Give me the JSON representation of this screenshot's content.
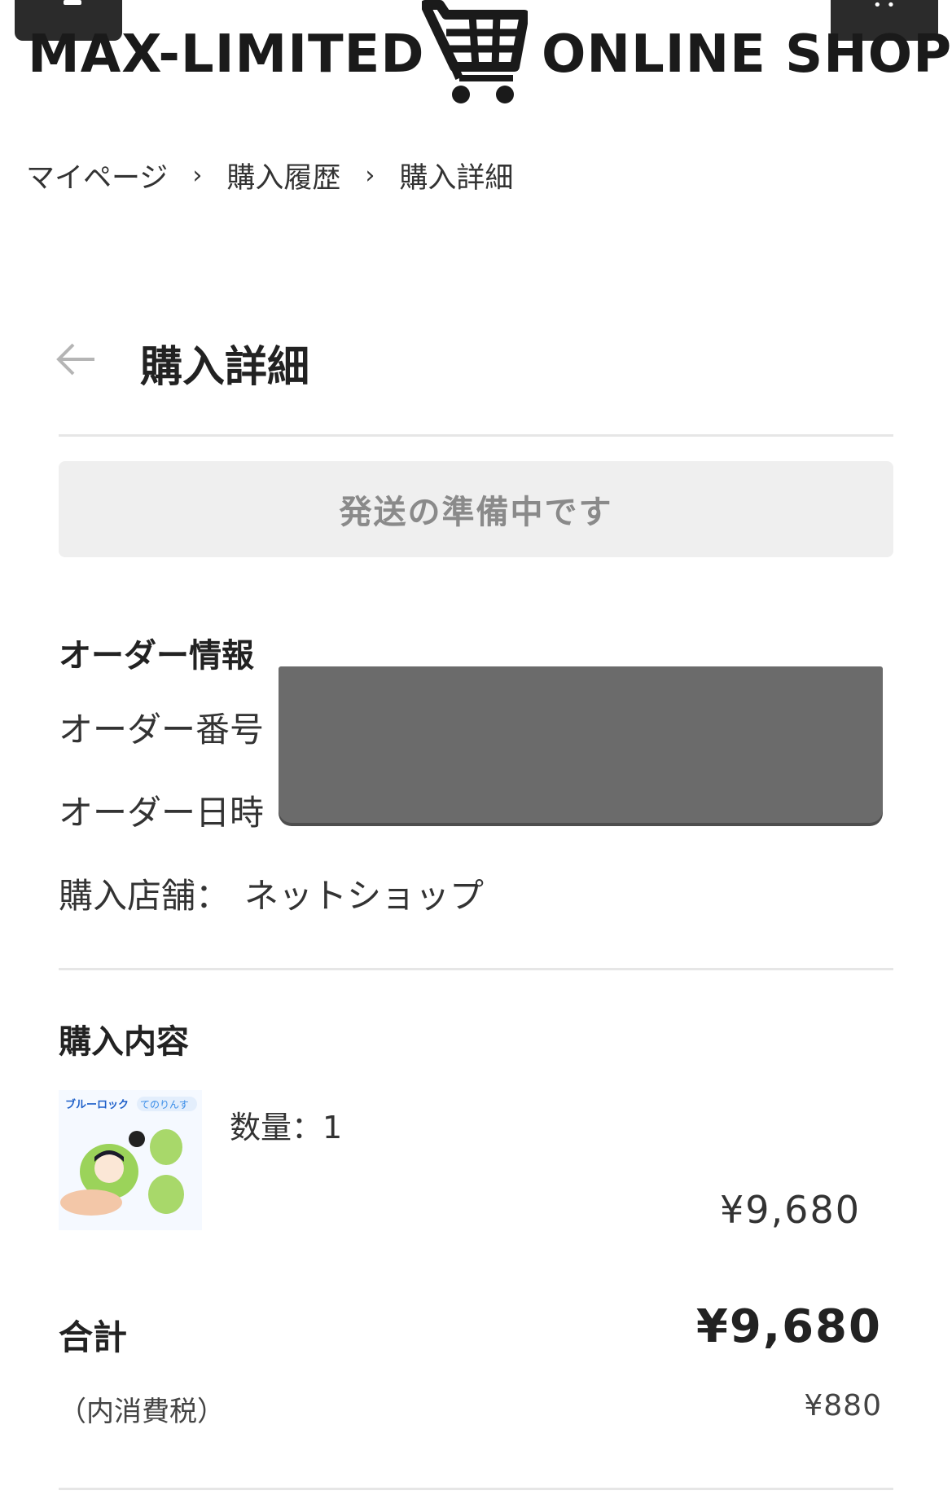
{
  "header": {
    "logo_left": "MAX-LIMITED",
    "logo_right": "ONLINE SHOP"
  },
  "breadcrumb": {
    "items": [
      "マイページ",
      "購入履歴",
      "購入詳細"
    ],
    "separator": "›"
  },
  "page": {
    "title": "購入詳細",
    "status": "発送の準備中です"
  },
  "order_info": {
    "heading": "オーダー情報",
    "order_number_label": "オーダー番号",
    "order_date_label": "オーダー日時",
    "store_label": "購入店舗：",
    "store_value": "ネットショップ"
  },
  "purchase": {
    "heading": "購入内容",
    "item": {
      "quantity_text": "数量：1",
      "price": "¥9,680",
      "thumb_brand": "ブルーロック",
      "thumb_series": "てのりんす"
    }
  },
  "totals": {
    "total_label": "合計",
    "total_value": "¥9,680",
    "tax_label": "（内消費税）",
    "tax_value": "¥880"
  },
  "colors": {
    "status_bg": "#efefef",
    "status_text": "#8a8a8a",
    "divider": "#e6e6e6",
    "redaction": "#6b6b6b"
  }
}
